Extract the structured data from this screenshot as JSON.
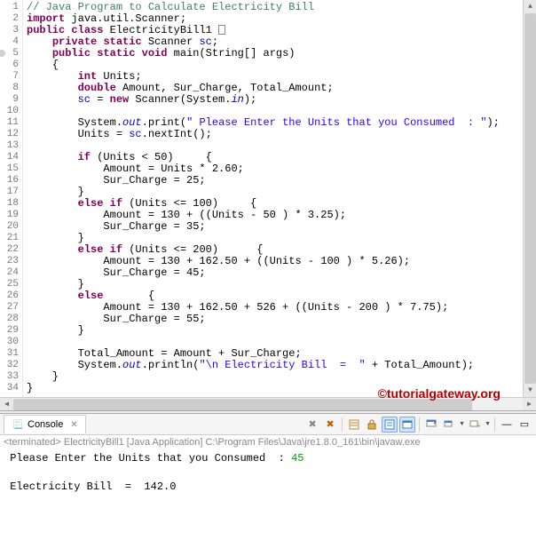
{
  "watermark": "©tutorialgateway.org",
  "code": {
    "lines": [
      {
        "n": "1",
        "segs": [
          {
            "c": "com",
            "t": "// Java Program to Calculate Electricity Bill"
          }
        ]
      },
      {
        "n": "2",
        "segs": [
          {
            "c": "kw",
            "t": "import"
          },
          {
            "t": " java.util.Scanner;"
          }
        ]
      },
      {
        "n": "3",
        "segs": [
          {
            "c": "kw",
            "t": "public"
          },
          {
            "t": " "
          },
          {
            "c": "kw",
            "t": "class"
          },
          {
            "t": " ElectricityBill1 "
          },
          {
            "box": true
          }
        ]
      },
      {
        "n": "4",
        "segs": [
          {
            "t": "    "
          },
          {
            "c": "kw",
            "t": "private"
          },
          {
            "t": " "
          },
          {
            "c": "kw",
            "t": "static"
          },
          {
            "t": " Scanner "
          },
          {
            "c": "stat-fld",
            "t": "sc"
          },
          {
            "t": ";"
          }
        ]
      },
      {
        "n": "5",
        "marker": true,
        "segs": [
          {
            "t": "    "
          },
          {
            "c": "kw",
            "t": "public"
          },
          {
            "t": " "
          },
          {
            "c": "kw",
            "t": "static"
          },
          {
            "t": " "
          },
          {
            "c": "kw",
            "t": "void"
          },
          {
            "t": " main(String[] args)"
          }
        ]
      },
      {
        "n": "6",
        "segs": [
          {
            "t": "    {"
          }
        ]
      },
      {
        "n": "7",
        "segs": [
          {
            "t": "        "
          },
          {
            "c": "kw",
            "t": "int"
          },
          {
            "t": " Units;"
          }
        ]
      },
      {
        "n": "8",
        "segs": [
          {
            "t": "        "
          },
          {
            "c": "kw",
            "t": "double"
          },
          {
            "t": " Amount, Sur_Charge, Total_Amount;"
          }
        ]
      },
      {
        "n": "9",
        "segs": [
          {
            "t": "        "
          },
          {
            "c": "stat-fld",
            "t": "sc"
          },
          {
            "t": " = "
          },
          {
            "c": "kw",
            "t": "new"
          },
          {
            "t": " Scanner(System."
          },
          {
            "c": "fld",
            "t": "in"
          },
          {
            "t": ");"
          }
        ]
      },
      {
        "n": "10",
        "segs": [
          {
            "t": ""
          }
        ]
      },
      {
        "n": "11",
        "segs": [
          {
            "t": "        System."
          },
          {
            "c": "fld",
            "t": "out"
          },
          {
            "t": ".print("
          },
          {
            "c": "str",
            "t": "\" Please Enter the Units that you Consumed  : \""
          },
          {
            "t": ");"
          }
        ]
      },
      {
        "n": "12",
        "segs": [
          {
            "t": "        Units = "
          },
          {
            "c": "stat-fld",
            "t": "sc"
          },
          {
            "t": ".nextInt();"
          }
        ]
      },
      {
        "n": "13",
        "segs": [
          {
            "t": ""
          }
        ]
      },
      {
        "n": "14",
        "segs": [
          {
            "t": "        "
          },
          {
            "c": "kw",
            "t": "if"
          },
          {
            "t": " (Units < 50)     {"
          }
        ]
      },
      {
        "n": "15",
        "segs": [
          {
            "t": "            Amount = Units * 2.60;"
          }
        ]
      },
      {
        "n": "16",
        "segs": [
          {
            "t": "            Sur_Charge = 25;"
          }
        ]
      },
      {
        "n": "17",
        "segs": [
          {
            "t": "        }"
          }
        ]
      },
      {
        "n": "18",
        "segs": [
          {
            "t": "        "
          },
          {
            "c": "kw",
            "t": "else"
          },
          {
            "t": " "
          },
          {
            "c": "kw",
            "t": "if"
          },
          {
            "t": " (Units <= 100)     {"
          }
        ]
      },
      {
        "n": "19",
        "segs": [
          {
            "t": "            Amount = 130 + ((Units - 50 ) * 3.25);"
          }
        ]
      },
      {
        "n": "20",
        "segs": [
          {
            "t": "            Sur_Charge = 35;"
          }
        ]
      },
      {
        "n": "21",
        "segs": [
          {
            "t": "        }"
          }
        ]
      },
      {
        "n": "22",
        "segs": [
          {
            "t": "        "
          },
          {
            "c": "kw",
            "t": "else"
          },
          {
            "t": " "
          },
          {
            "c": "kw",
            "t": "if"
          },
          {
            "t": " (Units <= 200)      {"
          }
        ]
      },
      {
        "n": "23",
        "segs": [
          {
            "t": "            Amount = 130 + 162.50 + ((Units - 100 ) * 5.26);"
          }
        ]
      },
      {
        "n": "24",
        "segs": [
          {
            "t": "            Sur_Charge = 45;"
          }
        ]
      },
      {
        "n": "25",
        "segs": [
          {
            "t": "        }"
          }
        ]
      },
      {
        "n": "26",
        "segs": [
          {
            "t": "        "
          },
          {
            "c": "kw",
            "t": "else"
          },
          {
            "t": "       {"
          }
        ]
      },
      {
        "n": "27",
        "segs": [
          {
            "t": "            Amount = 130 + 162.50 + 526 + ((Units - 200 ) * 7.75);"
          }
        ]
      },
      {
        "n": "28",
        "segs": [
          {
            "t": "            Sur_Charge = 55;"
          }
        ]
      },
      {
        "n": "29",
        "segs": [
          {
            "t": "        }"
          }
        ]
      },
      {
        "n": "30",
        "segs": [
          {
            "t": ""
          }
        ]
      },
      {
        "n": "31",
        "segs": [
          {
            "t": "        Total_Amount = Amount + Sur_Charge;"
          }
        ]
      },
      {
        "n": "32",
        "segs": [
          {
            "t": "        System."
          },
          {
            "c": "fld",
            "t": "out"
          },
          {
            "t": ".println("
          },
          {
            "c": "str",
            "t": "\"\\n Electricity Bill  =  \""
          },
          {
            "t": " + Total_Amount);"
          }
        ]
      },
      {
        "n": "33",
        "segs": [
          {
            "t": "    }"
          }
        ]
      },
      {
        "n": "34",
        "segs": [
          {
            "t": "}"
          }
        ]
      }
    ]
  },
  "console": {
    "tab_label": "Console",
    "terminated": "<terminated> ElectricityBill1 [Java Application] C:\\Program Files\\Java\\jre1.8.0_161\\bin\\javaw.exe",
    "prompt_text": " Please Enter the Units that you Consumed  : ",
    "user_input": "45",
    "result_text": " Electricity Bill  =  142.0"
  },
  "icons": {
    "console": "📃",
    "close": "✕",
    "remove_term": "✖",
    "remove_all": "✖",
    "clear": "🧹",
    "scroll_lock": "🔒",
    "pin": "📌",
    "display": "🖥",
    "new_con": "➕",
    "min": "—",
    "max": "▭"
  }
}
